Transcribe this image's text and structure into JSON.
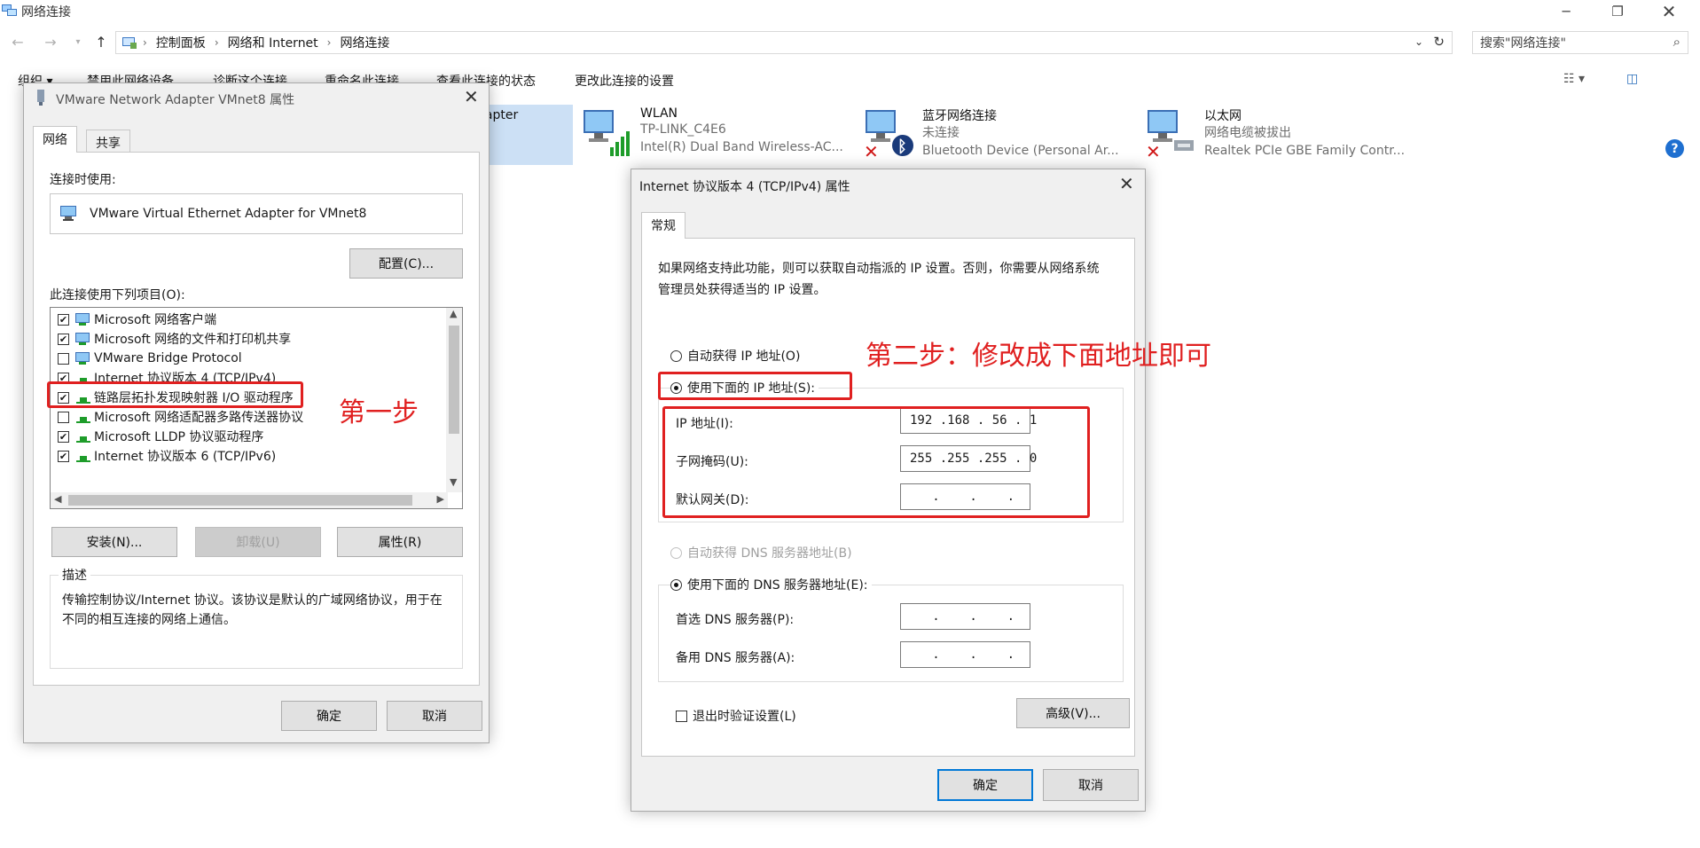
{
  "explorer": {
    "title": "网络连接",
    "breadcrumb": [
      "控制面板",
      "网络和 Internet",
      "网络连接"
    ],
    "search_placeholder": "搜索\"网络连接\"",
    "toolbar": {
      "organize": "组织 ▾",
      "disable": "禁用此网络设备",
      "diagnose": "诊断这个连接",
      "rename": "重命名此连接",
      "status": "查看此连接的状态",
      "change_settings": "更改此连接的设置"
    },
    "partial_connection_label": "dapter",
    "connections": [
      {
        "name": "WLAN",
        "status": "TP-LINK_C4E6",
        "device": "Intel(R) Dual Band Wireless-AC..."
      },
      {
        "name": "蓝牙网络连接",
        "status": "未连接",
        "device": "Bluetooth Device (Personal Ar..."
      },
      {
        "name": "以太网",
        "status": "网络电缆被拔出",
        "device": "Realtek PCIe GBE Family Contr..."
      }
    ]
  },
  "adapter_dialog": {
    "title": "VMware Network Adapter VMnet8 属性",
    "tabs": [
      "网络",
      "共享"
    ],
    "connect_using_label": "连接时使用:",
    "adapter_name": "VMware Virtual Ethernet Adapter for VMnet8",
    "configure_button": "配置(C)...",
    "items_label": "此连接使用下列项目(O):",
    "items": [
      {
        "label": "Microsoft 网络客户端",
        "checked": true
      },
      {
        "label": "Microsoft 网络的文件和打印机共享",
        "checked": true
      },
      {
        "label": "VMware Bridge Protocol",
        "checked": false
      },
      {
        "label": "Internet 协议版本 4 (TCP/IPv4)",
        "checked": true
      },
      {
        "label": "链路层拓扑发现映射器 I/O 驱动程序",
        "checked": true
      },
      {
        "label": "Microsoft 网络适配器多路传送器协议",
        "checked": false
      },
      {
        "label": "Microsoft LLDP 协议驱动程序",
        "checked": true
      },
      {
        "label": "Internet 协议版本 6 (TCP/IPv6)",
        "checked": true
      }
    ],
    "install_button": "安装(N)...",
    "uninstall_button": "卸载(U)",
    "properties_button": "属性(R)",
    "description_label": "描述",
    "description_text": "传输控制协议/Internet 协议。该协议是默认的广域网络协议，用于在不同的相互连接的网络上通信。",
    "ok_button": "确定",
    "cancel_button": "取消"
  },
  "ipv4_dialog": {
    "title": "Internet 协议版本 4 (TCP/IPv4) 属性",
    "tab": "常规",
    "intro": "如果网络支持此功能，则可以获取自动指派的 IP 设置。否则，你需要从网络系统管理员处获得适当的 IP 设置。",
    "auto_ip_label": "自动获得 IP 地址(O)",
    "manual_ip_label": "使用下面的 IP 地址(S):",
    "ip_label": "IP 地址(I):",
    "ip_value": "192 .168 . 56 . 1",
    "mask_label": "子网掩码(U):",
    "mask_value": "255 .255 .255 . 0",
    "gateway_label": "默认网关(D):",
    "gateway_value": "   .    .    .",
    "auto_dns_label": "自动获得 DNS 服务器地址(B)",
    "manual_dns_label": "使用下面的 DNS 服务器地址(E):",
    "preferred_dns_label": "首选 DNS 服务器(P):",
    "preferred_dns_value": "   .    .    .",
    "alternate_dns_label": "备用 DNS 服务器(A):",
    "alternate_dns_value": "   .    .    .",
    "validate_label": "退出时验证设置(L)",
    "advanced_button": "高级(V)...",
    "ok_button": "确定",
    "cancel_button": "取消"
  },
  "annotations": {
    "step1": "第一步",
    "step2": "第二步：修改成下面地址即可"
  },
  "colors": {
    "annotation_red": "#e02020",
    "accent_blue": "#0078d7"
  }
}
